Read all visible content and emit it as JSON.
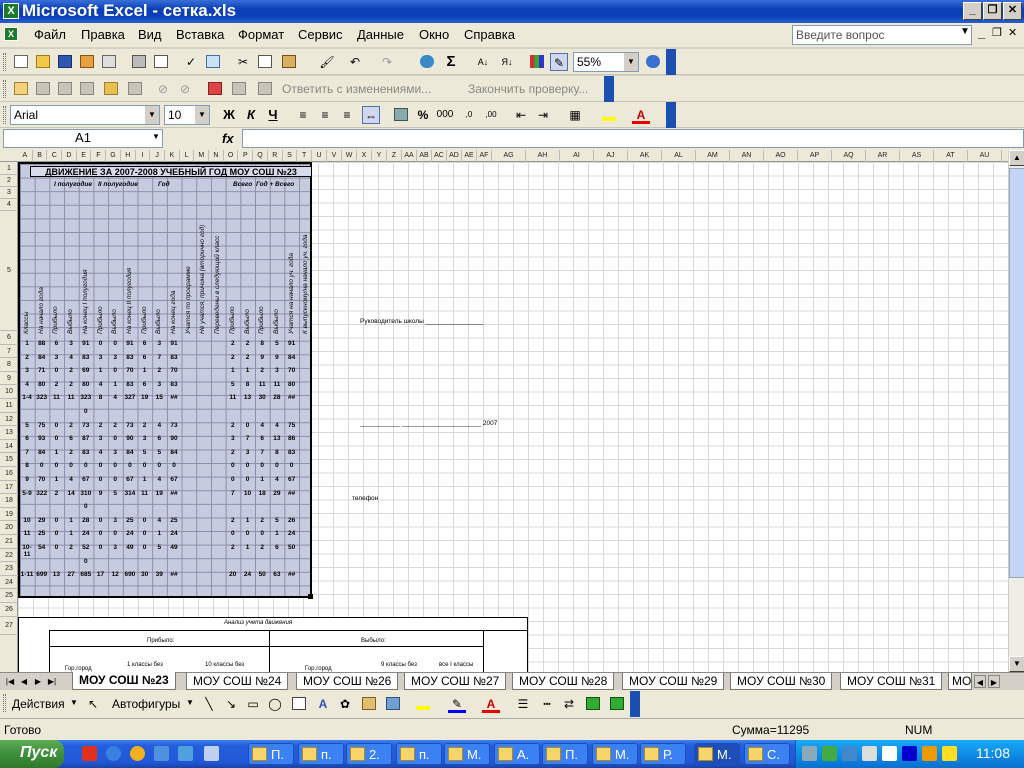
{
  "window": {
    "title": "Microsoft Excel - сетка.xls",
    "minimize": "_",
    "restore": "❐",
    "close": "✕"
  },
  "menu": {
    "items": [
      "Файл",
      "Правка",
      "Вид",
      "Вставка",
      "Формат",
      "Сервис",
      "Данные",
      "Окно",
      "Справка"
    ],
    "ask_placeholder": "Введите вопрос",
    "doc_min": "_",
    "doc_restore": "❐",
    "doc_close": "✕"
  },
  "toolbar_standard": {
    "zoom": "55%"
  },
  "toolbar_review": {
    "reply_changes": "Ответить с изменениями...",
    "end_review": "Закончить проверку..."
  },
  "toolbar_format": {
    "font": "Arial",
    "size": "10",
    "bold": "Ж",
    "italic": "К",
    "underline": "Ч",
    "percent": "%",
    "thousands": "000"
  },
  "formula_bar": {
    "name_box": "A1",
    "fx": "fx",
    "content": ""
  },
  "columns": [
    "A",
    "B",
    "C",
    "D",
    "E",
    "F",
    "G",
    "H",
    "I",
    "J",
    "K",
    "L",
    "M",
    "N",
    "O",
    "P",
    "Q",
    "R",
    "S",
    "T",
    "U",
    "V",
    "W",
    "X",
    "Y",
    "Z",
    "AA",
    "AB",
    "AC",
    "AD",
    "AE",
    "AF",
    "AG",
    "AH",
    "AI",
    "AJ",
    "AK",
    "AL",
    "AM",
    "AN",
    "AO",
    "AP",
    "AQ",
    "AR",
    "AS",
    "AT",
    "AU"
  ],
  "rows": [
    "1",
    "2",
    "3",
    "4",
    "5",
    "6",
    "7",
    "8",
    "9",
    "10",
    "11",
    "12",
    "13",
    "14",
    "15",
    "16",
    "17",
    "18",
    "19",
    "20",
    "21",
    "22",
    "23",
    "24",
    "25",
    "26",
    "27"
  ],
  "sheet": {
    "title": "ДВИЖЕНИЕ ЗА 2007-2008 УЧЕБНЫЙ ГОД МОУ СОШ №23",
    "headers": {
      "h1": "I полугодие",
      "h2": "II полугодие",
      "h3": "Год",
      "h4": "Всего",
      "h5": "Год + Всего"
    },
    "vertical_labels": [
      "Классы",
      "На начало года",
      "Прибыло",
      "Выбыло",
      "На конец I полугодия",
      "Прибыло",
      "Выбыло",
      "На конец II полугодия",
      "Прибыло",
      "Выбыло",
      "На конец года",
      "Учатся по программе",
      "Не учатся, причина (вторично год)",
      "Переведены в следующий класс",
      "Прибыло",
      "Выбыло",
      "Прибыло",
      "Выбыло",
      "Учатся на начало уч. года",
      "К выпускному/на начало уч. года"
    ],
    "rows": [
      [
        "1",
        "88",
        "6",
        "3",
        "91",
        "0",
        "0",
        "91",
        "6",
        "3",
        "91",
        "",
        "",
        "",
        "2",
        "2",
        "8",
        "5",
        "91"
      ],
      [
        "2",
        "84",
        "3",
        "4",
        "83",
        "3",
        "3",
        "83",
        "6",
        "7",
        "83",
        "",
        "",
        "",
        "2",
        "2",
        "9",
        "9",
        "84"
      ],
      [
        "3",
        "71",
        "0",
        "2",
        "69",
        "1",
        "0",
        "70",
        "1",
        "2",
        "70",
        "",
        "",
        "",
        "1",
        "1",
        "2",
        "3",
        "70"
      ],
      [
        "4",
        "80",
        "2",
        "2",
        "80",
        "4",
        "1",
        "83",
        "6",
        "3",
        "83",
        "",
        "",
        "",
        "5",
        "8",
        "11",
        "11",
        "80"
      ],
      [
        "1-4",
        "323",
        "11",
        "11",
        "323",
        "8",
        "4",
        "327",
        "19",
        "15",
        "##",
        "",
        "",
        "",
        "11",
        "13",
        "30",
        "28",
        "##"
      ],
      [
        "",
        "",
        "",
        "",
        "0",
        "",
        "",
        "",
        "",
        "",
        "",
        "",
        "",
        "",
        "",
        "",
        "",
        "",
        "",
        ""
      ],
      [
        "5",
        "75",
        "0",
        "2",
        "73",
        "2",
        "2",
        "73",
        "2",
        "4",
        "73",
        "",
        "",
        "",
        "2",
        "0",
        "4",
        "4",
        "75"
      ],
      [
        "6",
        "93",
        "0",
        "6",
        "87",
        "3",
        "0",
        "90",
        "3",
        "6",
        "90",
        "",
        "",
        "",
        "3",
        "7",
        "6",
        "13",
        "86"
      ],
      [
        "7",
        "84",
        "1",
        "2",
        "83",
        "4",
        "3",
        "84",
        "5",
        "5",
        "84",
        "",
        "",
        "",
        "2",
        "3",
        "7",
        "8",
        "83"
      ],
      [
        "8",
        "0",
        "0",
        "0",
        "0",
        "0",
        "0",
        "0",
        "0",
        "0",
        "0",
        "",
        "",
        "",
        "0",
        "0",
        "0",
        "0",
        "0"
      ],
      [
        "9",
        "70",
        "1",
        "4",
        "67",
        "0",
        "0",
        "67",
        "1",
        "4",
        "67",
        "",
        "",
        "",
        "0",
        "0",
        "1",
        "4",
        "67"
      ],
      [
        "5-9",
        "322",
        "2",
        "14",
        "310",
        "9",
        "5",
        "314",
        "11",
        "19",
        "##",
        "",
        "",
        "",
        "7",
        "10",
        "18",
        "29",
        "##"
      ],
      [
        "",
        "",
        "",
        "",
        "0",
        "",
        "",
        "",
        "",
        "",
        "",
        "",
        "",
        "",
        "",
        "",
        "",
        "",
        "",
        ""
      ],
      [
        "10",
        "29",
        "0",
        "1",
        "28",
        "0",
        "3",
        "25",
        "0",
        "4",
        "25",
        "",
        "",
        "",
        "2",
        "1",
        "2",
        "5",
        "26"
      ],
      [
        "11",
        "25",
        "0",
        "1",
        "24",
        "0",
        "0",
        "24",
        "0",
        "1",
        "24",
        "",
        "",
        "",
        "0",
        "0",
        "0",
        "1",
        "24"
      ],
      [
        "10-11",
        "54",
        "0",
        "2",
        "52",
        "0",
        "3",
        "49",
        "0",
        "5",
        "49",
        "",
        "",
        "",
        "2",
        "1",
        "2",
        "6",
        "50"
      ],
      [
        "",
        "",
        "",
        "",
        "0",
        "",
        "",
        "",
        "",
        "",
        "",
        "",
        "",
        "",
        "",
        "",
        "",
        "",
        "",
        ""
      ],
      [
        "1-11",
        "699",
        "13",
        "27",
        "685",
        "17",
        "12",
        "690",
        "30",
        "39",
        "##",
        "",
        "",
        "",
        "20",
        "24",
        "50",
        "63",
        "##"
      ]
    ],
    "note_director": "Руководитель школы ________________",
    "note_date": "___________ ______________________ 2007",
    "note_phone": "телефон",
    "bottom_title": "Анализ учета движения",
    "bottom_prib": "Прибыло:",
    "bottom_vyb": "Выбыло:",
    "bottom_c1": "Гор.город",
    "bottom_c2": "1 классы без",
    "bottom_c3": "10 классы без",
    "bottom_c4": "Гор.город",
    "bottom_c5": "9 классы без",
    "bottom_c6": "все I классы"
  },
  "sheet_tabs": [
    "МОУ СОШ №23",
    "МОУ СОШ №24",
    "МОУ СОШ №26",
    "МОУ СОШ №27",
    "МОУ СОШ №28",
    "МОУ СОШ №29",
    "МОУ СОШ №30",
    "МОУ СОШ №31",
    "МО"
  ],
  "drawing": {
    "actions": "Действия",
    "autoshapes": "Автофигуры"
  },
  "status": {
    "ready": "Готово",
    "sum": "Сумма=11295",
    "num": "NUM"
  },
  "taskbar": {
    "start": "Пуск",
    "tasks": [
      "П.",
      "п.",
      "2.",
      "п.",
      "М.",
      "А.",
      "П.",
      "М.",
      "Р.",
      "М.",
      "С."
    ],
    "clock": "11:08"
  }
}
